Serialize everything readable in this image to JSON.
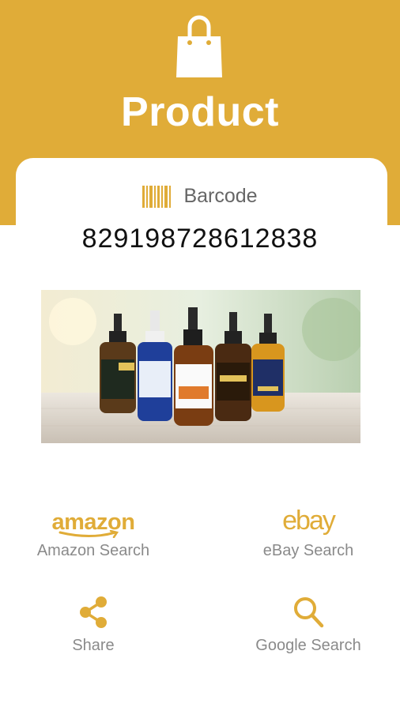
{
  "header": {
    "title": "Product",
    "icon": "shopping-bag-icon"
  },
  "barcode": {
    "label": "Barcode",
    "value": "829198728612838",
    "icon": "barcode-icon"
  },
  "actions": [
    {
      "label": "Amazon Search",
      "logo_text": "amazon",
      "icon": "amazon-logo"
    },
    {
      "label": "eBay Search",
      "logo_text": "ebay",
      "icon": "ebay-logo"
    },
    {
      "label": "Share",
      "icon": "share-icon"
    },
    {
      "label": "Google Search",
      "icon": "search-icon"
    }
  ],
  "colors": {
    "accent": "#e0ac38",
    "label_gray": "#8a8a8a",
    "text_dark": "#111111"
  }
}
